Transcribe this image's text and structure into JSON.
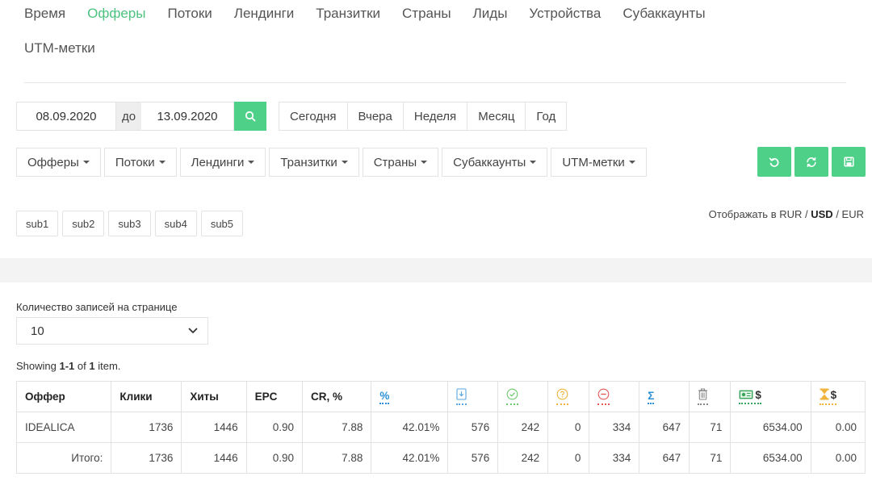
{
  "nav": {
    "tabs": [
      "Время",
      "Офферы",
      "Потоки",
      "Лендинги",
      "Транзитки",
      "Страны",
      "Лиды",
      "Устройства",
      "Субаккаунты"
    ],
    "active_index": 1,
    "tab_row2": "UTM-метки",
    "active_color": "#4cc27e"
  },
  "date_filter": {
    "from": "08.09.2020",
    "separator": "до",
    "to": "13.09.2020",
    "search_icon": "search-icon",
    "accent_color": "#4fd089"
  },
  "periods": [
    "Сегодня",
    "Вчера",
    "Неделя",
    "Месяц",
    "Год"
  ],
  "filters": [
    "Офферы",
    "Потоки",
    "Лендинги",
    "Транзитки",
    "Страны",
    "Субаккаунты",
    "UTM-метки"
  ],
  "actions": [
    "undo-icon",
    "refresh-icon",
    "save-icon"
  ],
  "subs": [
    "sub1",
    "sub2",
    "sub3",
    "sub4",
    "sub5"
  ],
  "currency": {
    "prefix": "Отображать в",
    "options": [
      "RUR",
      "USD",
      "EUR"
    ],
    "selected": "USD",
    "separator": " / "
  },
  "page_size": {
    "label": "Количество записей на странице",
    "value": "10"
  },
  "summary": {
    "showing": "Showing",
    "range": "1-1",
    "of": "of",
    "count": "1",
    "suffix": "item."
  },
  "table": {
    "headers": [
      "Оффер",
      "Клики",
      "Хиты",
      "EPC",
      "CR, %"
    ],
    "icon_headers": [
      {
        "type": "text",
        "text": "%",
        "color": "#2b8fd6"
      },
      {
        "type": "icon",
        "icon": "download-icon",
        "color": "#5aa6e0"
      },
      {
        "type": "icon",
        "icon": "check-circle-icon",
        "color": "#6cc86c"
      },
      {
        "type": "icon",
        "icon": "question-circle-icon",
        "color": "#f0b43c"
      },
      {
        "type": "icon",
        "icon": "minus-circle-icon",
        "color": "#e05a5a"
      },
      {
        "type": "text",
        "text": "Σ",
        "color": "#2b8fd6"
      },
      {
        "type": "icon",
        "icon": "trash-icon",
        "color": "#888888"
      },
      {
        "type": "icon-text",
        "icon": "money-icon",
        "text": "$",
        "color": "#3aa35a"
      },
      {
        "type": "icon-text",
        "icon": "hourglass-icon",
        "text": "$",
        "color": "#f0b43c"
      }
    ],
    "rows": [
      [
        "IDEALICA",
        "1736",
        "1446",
        "0.90",
        "7.88",
        "42.01%",
        "576",
        "242",
        "0",
        "334",
        "647",
        "71",
        "6534.00",
        "0.00"
      ]
    ],
    "total": [
      "Итого:",
      "1736",
      "1446",
      "0.90",
      "7.88",
      "42.01%",
      "576",
      "242",
      "0",
      "334",
      "647",
      "71",
      "6534.00",
      "0.00"
    ]
  }
}
